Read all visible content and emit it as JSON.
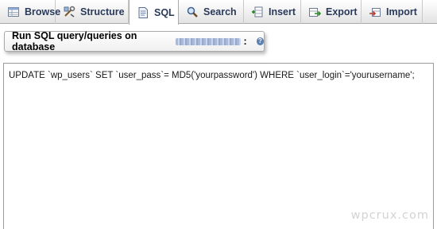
{
  "tabs": [
    {
      "label": "Browse",
      "icon": "browse-table-icon",
      "active": false
    },
    {
      "label": "Structure",
      "icon": "structure-icon",
      "active": false
    },
    {
      "label": "SQL",
      "icon": "sql-document-icon",
      "active": true
    },
    {
      "label": "Search",
      "icon": "magnifier-search-icon",
      "active": false
    },
    {
      "label": "Insert",
      "icon": "insert-row-icon",
      "active": false
    },
    {
      "label": "Export",
      "icon": "export-icon",
      "active": false
    },
    {
      "label": "Import",
      "icon": "import-icon",
      "active": false
    }
  ],
  "query_panel": {
    "legend_label": "Run SQL query/queries on database",
    "legend_suffix": ":",
    "help_icon": "help-icon",
    "query_text": "UPDATE `wp_users` SET `user_pass`= MD5('yourpassword') WHERE `user_login`='yourusername';"
  },
  "watermark": "wpcrux.com",
  "colors": {
    "tab_text": "#2a3a5a",
    "border": "#aaaaaa",
    "help_icon": "#5c7fb4"
  }
}
